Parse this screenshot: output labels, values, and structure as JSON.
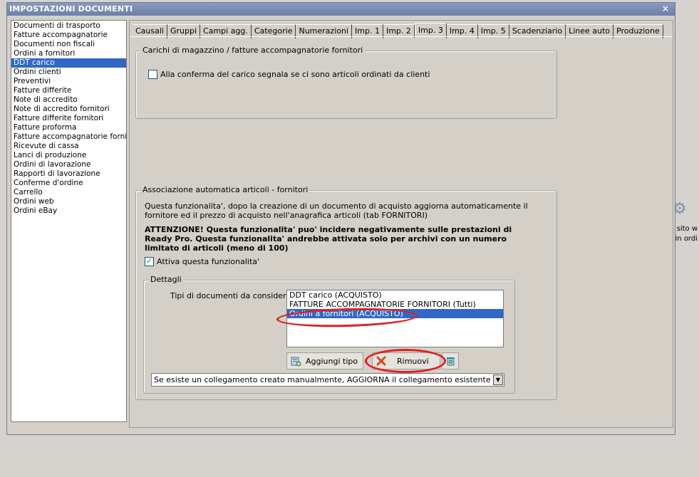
{
  "window": {
    "title": "IMPOSTAZIONI DOCUMENTI",
    "close_glyph": "×"
  },
  "background": {
    "text_line1": "sito w",
    "text_line2": "i in ordi",
    "gear_icon": "gear-icon"
  },
  "sidebar": {
    "items": [
      {
        "label": "Documenti di trasporto"
      },
      {
        "label": "Fatture accompagnatorie"
      },
      {
        "label": "Documenti non fiscali"
      },
      {
        "label": "Ordini a fornitori"
      },
      {
        "label": "DDT carico",
        "selected": true
      },
      {
        "label": "Ordini clienti"
      },
      {
        "label": "Preventivi"
      },
      {
        "label": "Fatture differite"
      },
      {
        "label": "Note di accredito"
      },
      {
        "label": "Note di accredito fornitori"
      },
      {
        "label": "Fatture differite fornitori"
      },
      {
        "label": "Fatture proforma"
      },
      {
        "label": "Fatture accompagnatorie fornito"
      },
      {
        "label": "Ricevute di cassa"
      },
      {
        "label": "Lanci di produzione"
      },
      {
        "label": "Ordini di lavorazione"
      },
      {
        "label": "Rapporti di lavorazione"
      },
      {
        "label": "Conferme d'ordine"
      },
      {
        "label": "Carrello"
      },
      {
        "label": "Ordini web"
      },
      {
        "label": "Ordini eBay"
      }
    ]
  },
  "tabs": [
    {
      "label": "Causali"
    },
    {
      "label": "Gruppi"
    },
    {
      "label": "Campi agg."
    },
    {
      "label": "Categorie"
    },
    {
      "label": "Numerazioni"
    },
    {
      "label": "Imp. 1"
    },
    {
      "label": "Imp. 2"
    },
    {
      "label": "Imp. 3",
      "active": true
    },
    {
      "label": "Imp. 4"
    },
    {
      "label": "Imp. 5"
    },
    {
      "label": "Scadenziario"
    },
    {
      "label": "Linee auto"
    },
    {
      "label": "Produzione"
    }
  ],
  "group_carichi": {
    "label": "Carichi di magazzino / fatture accompagnatorie fornitori",
    "checkbox_label": "Alla conferma del carico segnala se ci sono articoli ordinati da clienti",
    "checkbox_checked": false
  },
  "group_associazione": {
    "label": "Associazione automatica articoli - fornitori",
    "description_line1": "Questa funzionalita', dopo la creazione di un documento di acquisto aggiorna automaticamente il",
    "description_line2": "fornitore ed il prezzo di acquisto nell'anagrafica articoli (tab FORNITORI)",
    "warning_line1": "ATTENZIONE! Questa funzionalita' puo' incidere negativamente sulle prestazioni di",
    "warning_line2": "Ready Pro. Questa funzionalita' andrebbe attivata solo per archivi con un numero",
    "warning_line3": "limitato di articoli (meno di 100)",
    "enable_label": "Attiva questa funzionalita'",
    "enable_checked": true
  },
  "dettagli": {
    "label": "Dettagli",
    "doc_types_label": "Tipi di documenti da considerare:",
    "doc_types": [
      {
        "label": "DDT carico (ACQUISTO)"
      },
      {
        "label": "FATTURE ACCOMPAGNATORIE FORNITORI (Tutti)"
      },
      {
        "label": "Ordini a fornitori (ACQUISTO)",
        "selected": true
      }
    ],
    "add_button": "Aggiungi tipo",
    "remove_button": "Rimuovi",
    "link_mode_select": "Se esiste un collegamento creato manualmente, AGGIORNA il collegamento esistente"
  },
  "colors": {
    "selection": "#3168c5",
    "titlebar": "#7a8bb5",
    "highlight_annotation": "#e02020"
  }
}
